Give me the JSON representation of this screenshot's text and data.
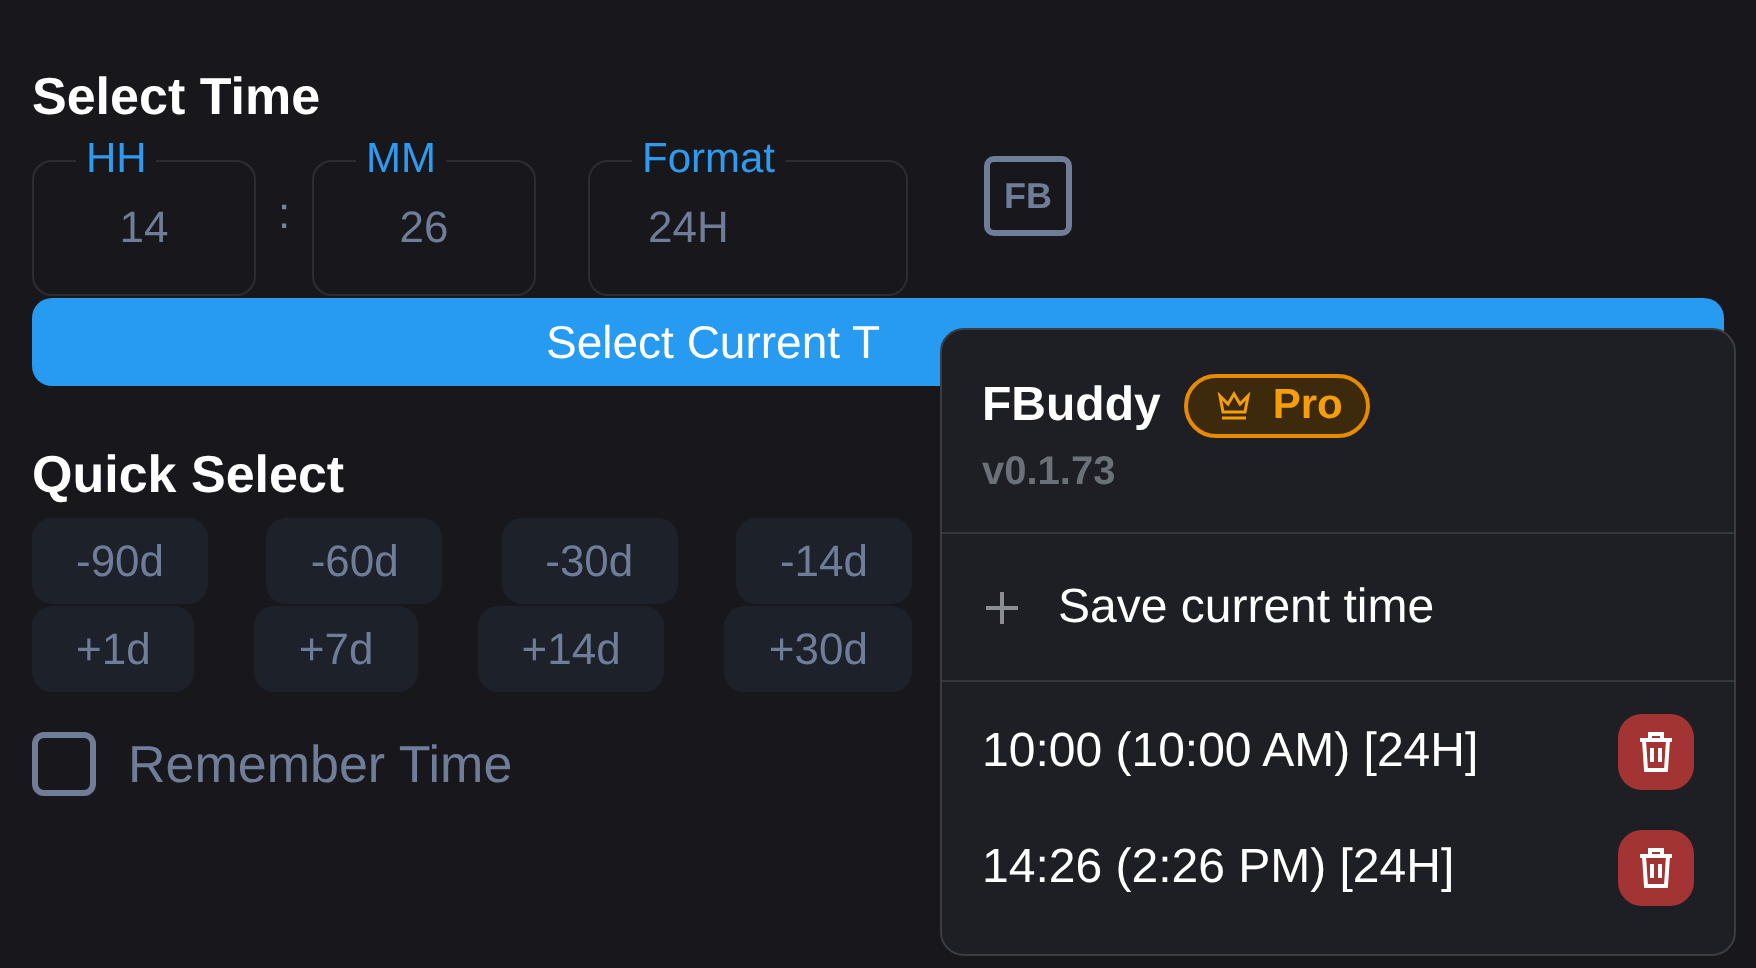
{
  "title": "Select Time",
  "fields": [
    {
      "label": "HH",
      "value": "14"
    },
    {
      "label": "MM",
      "value": "26"
    },
    {
      "label": "Format",
      "value": "24H"
    }
  ],
  "separator": ":",
  "logo": "FB",
  "current_button": "Select Current T",
  "quick_select": {
    "title": "Quick Select",
    "rows": [
      [
        "-90d",
        "-60d",
        "-30d",
        "-14d"
      ],
      [
        "+1d",
        "+7d",
        "+14d",
        "+30d"
      ]
    ]
  },
  "remember": {
    "label": "Remember Time",
    "checked": false
  },
  "menu": {
    "app_name": "FBuddy",
    "badge": "Pro",
    "version": "v0.1.73",
    "action": "Save current time",
    "saved": [
      {
        "text": "10:00 (10:00 AM) [24H]"
      },
      {
        "text": "14:26 (2:26 PM) [24H]"
      }
    ]
  }
}
